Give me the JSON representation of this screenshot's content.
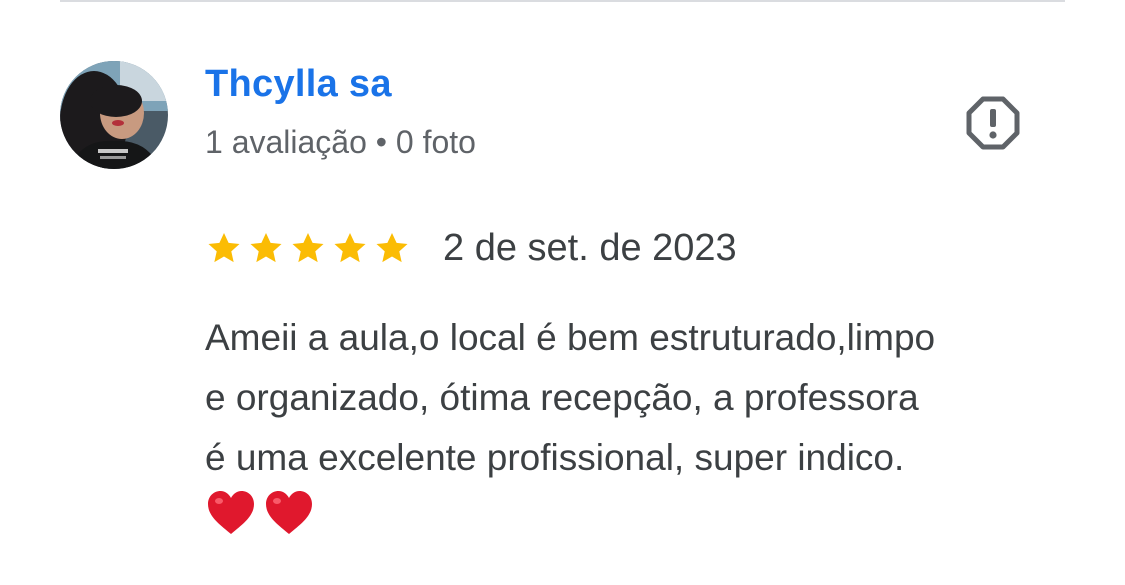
{
  "reviewer": {
    "name": "Thcylla sa",
    "meta": "1 avaliação • 0 foto"
  },
  "review": {
    "rating": 5,
    "rating_max": 5,
    "date": "2 de set. de 2023",
    "text_lines": [
      "Ameii a aula,o local é bem estruturado,limpo",
      "e organizado, ótima recepção, a professora",
      "é uma excelente profissional, super indico."
    ],
    "emoji": [
      "❤️",
      "❤️"
    ]
  },
  "icons": {
    "report": "report-flag-icon",
    "star": "star-icon",
    "heart": "heart-emoji-icon"
  },
  "colors": {
    "name": "#1a73e8",
    "star": "#fbbc04",
    "text": "#3c4043",
    "meta": "#5f6368",
    "report_icon": "#5f6368",
    "heart": "#e0182d"
  }
}
